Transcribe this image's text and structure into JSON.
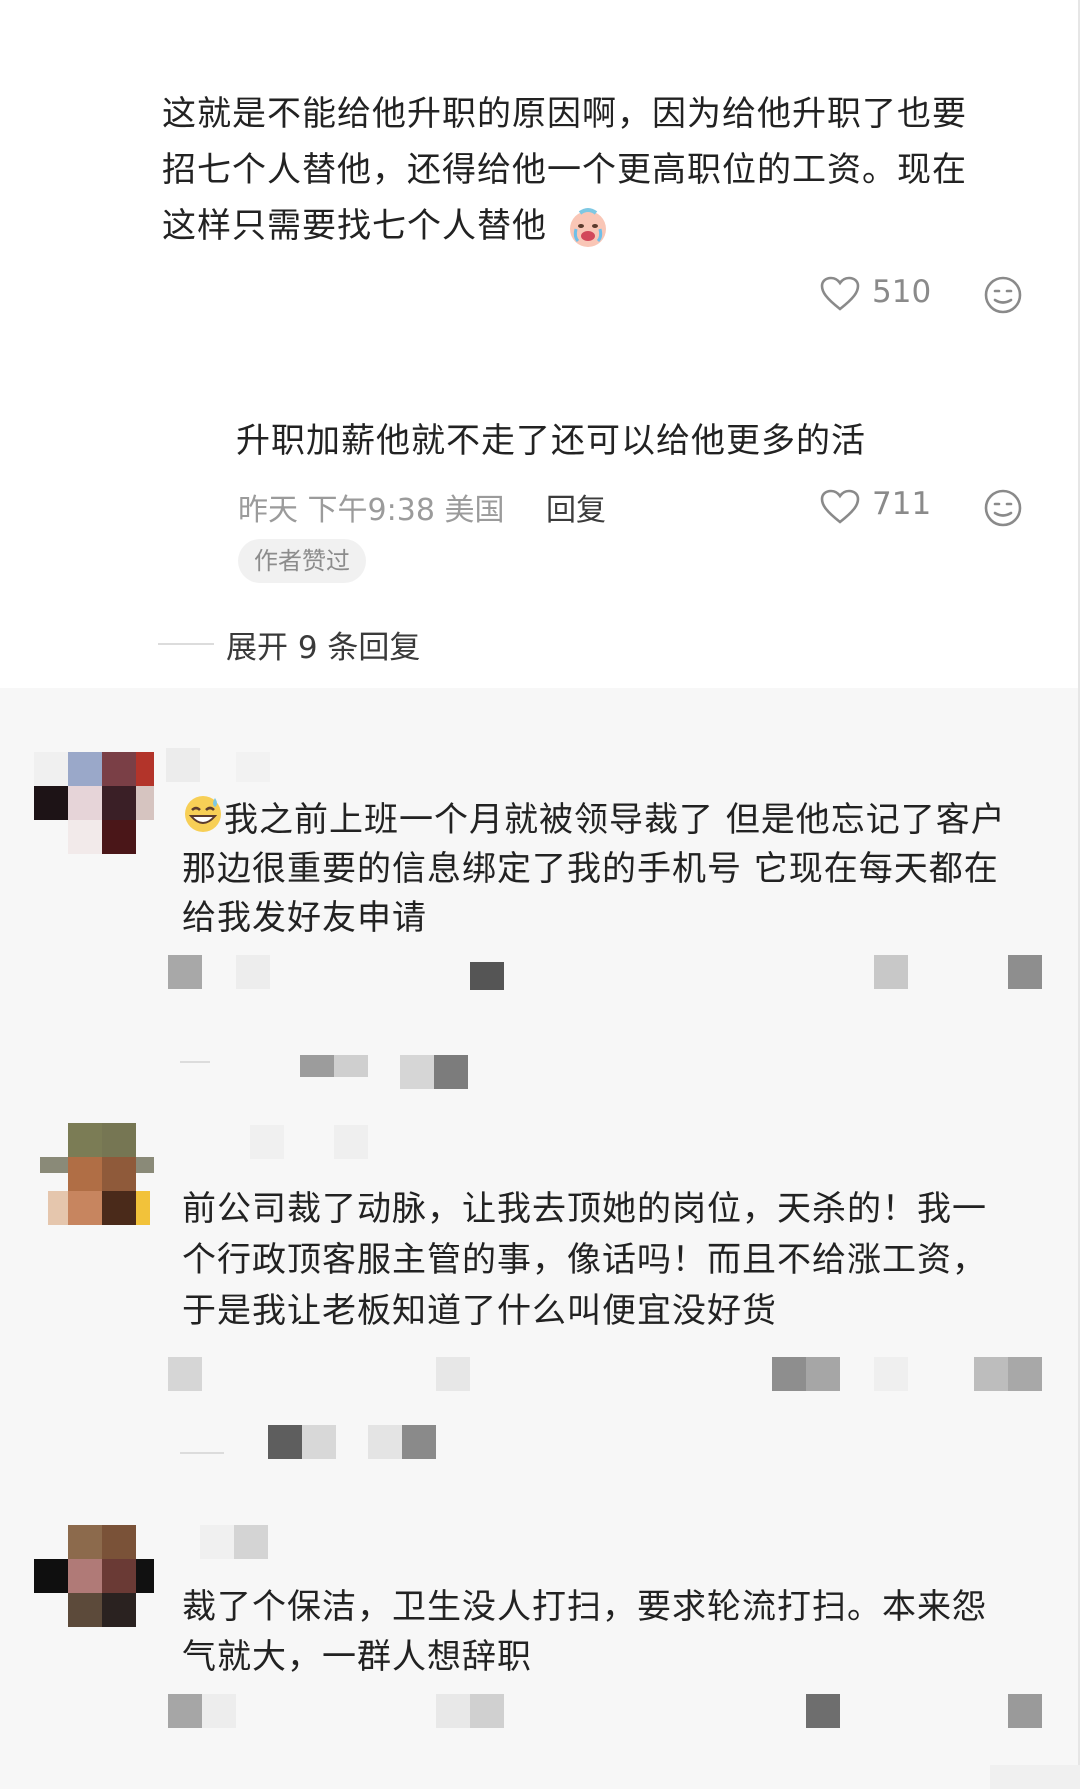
{
  "comments": [
    {
      "text_lines": [
        "这就是不能给他升职的原因啊，因为给他升职了也要",
        "招七个人替他，还得给他一个更高职位的工资。现在",
        "这样只需要找七个人替他"
      ],
      "emoji": "crying-face",
      "likes": "510"
    },
    {
      "text": "升职加薪他就不走了还可以给他更多的活",
      "meta": "昨天 下午9:38 美国",
      "reply_label": "回复",
      "likes": "711",
      "badge": "作者赞过"
    }
  ],
  "expand_replies": "展开 9 条回复",
  "comments2": [
    {
      "text_lines": [
        "我之前上班一个月就被领导裁了 但是他忘记了客户",
        "那边很重要的信息绑定了我的手机号 它现在每天都在",
        "给我发好友申请"
      ],
      "emoji": "grinning-sweat-face"
    },
    {
      "text_lines": [
        "前公司裁了动脉，让我去顶她的岗位，天杀的！我一",
        "个行政顶客服主管的事，像话吗！而且不给涨工资，",
        "于是我让老板知道了什么叫便宜没好货"
      ]
    },
    {
      "text_lines": [
        "裁了个保洁，卫生没人打扫，要求轮流打扫。本来怨",
        "气就大，一群人想辞职"
      ]
    }
  ],
  "colors": {
    "text": "#222222",
    "meta": "#9b9b9b",
    "badge_bg": "#f1f1f1",
    "icon": "#8a8a8a"
  }
}
